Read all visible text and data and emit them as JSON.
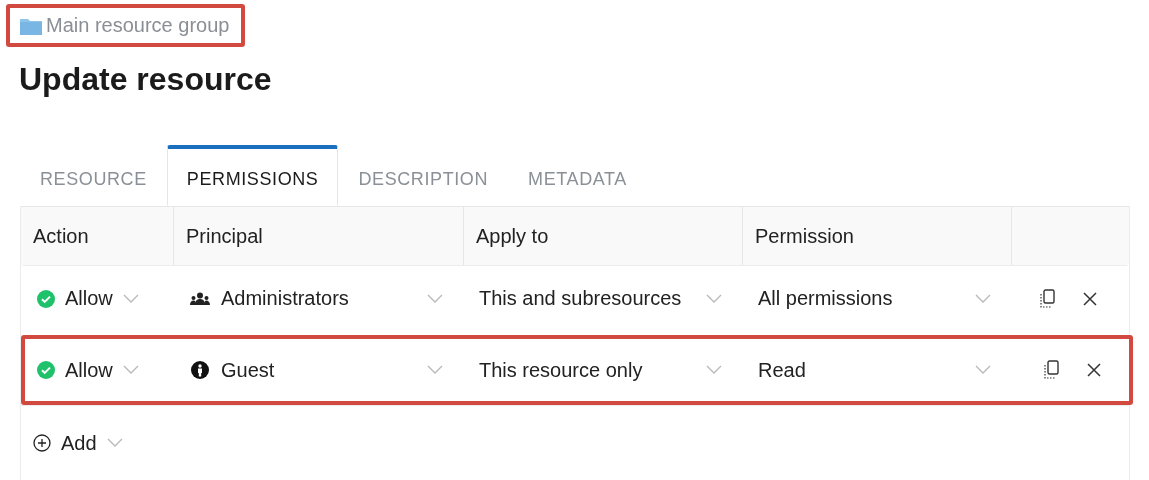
{
  "breadcrumb": {
    "label": "Main resource group",
    "highlighted": true
  },
  "title": "Update resource",
  "tabs": [
    {
      "label": "RESOURCE",
      "selected": false
    },
    {
      "label": "PERMISSIONS",
      "selected": true
    },
    {
      "label": "DESCRIPTION",
      "selected": false
    },
    {
      "label": "METADATA",
      "selected": false
    }
  ],
  "table": {
    "columns": [
      "Action",
      "Principal",
      "Apply to",
      "Permission"
    ],
    "rows": [
      {
        "action": "Allow",
        "principal": {
          "label": "Administrators",
          "kind": "group"
        },
        "apply_to": "This and subresources",
        "permission": "All permissions",
        "highlighted": false
      },
      {
        "action": "Allow",
        "principal": {
          "label": "Guest",
          "kind": "user"
        },
        "apply_to": "This resource only",
        "permission": "Read",
        "highlighted": true
      }
    ],
    "add_label": "Add"
  }
}
